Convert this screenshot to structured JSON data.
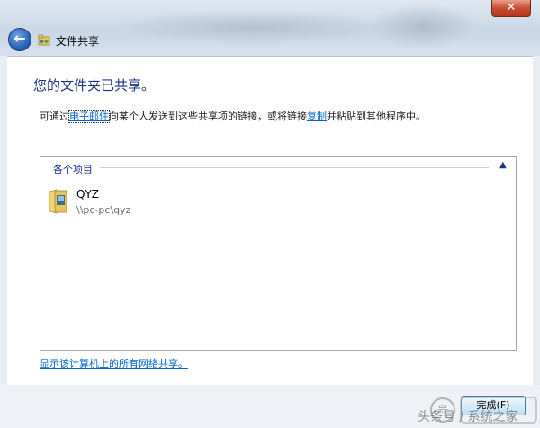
{
  "window": {
    "title": "文件共享",
    "close_symbol": "✕",
    "back_symbol": "←"
  },
  "heading": "您的文件夹已共享。",
  "description": {
    "part1": "可通过",
    "link_email": "电子邮件",
    "part2": "向某个人发送到这些共享项的链接，或将链接",
    "link_copy": "复制",
    "part3": "并粘贴到其他程序中。"
  },
  "items_group": {
    "title": "各个项目",
    "items": [
      {
        "name": "QYZ",
        "path": "\\\\pc-pc\\qyz",
        "icon": "shared-folder-icon"
      }
    ]
  },
  "show_all_link": "显示该计算机上的所有网络共享。",
  "finish_button": "完成(F)",
  "watermark_text": "头条号 / 系统之家",
  "colors": {
    "accent_title": "#1e3287",
    "link": "#0066cc",
    "close_button": "#c74c32"
  }
}
